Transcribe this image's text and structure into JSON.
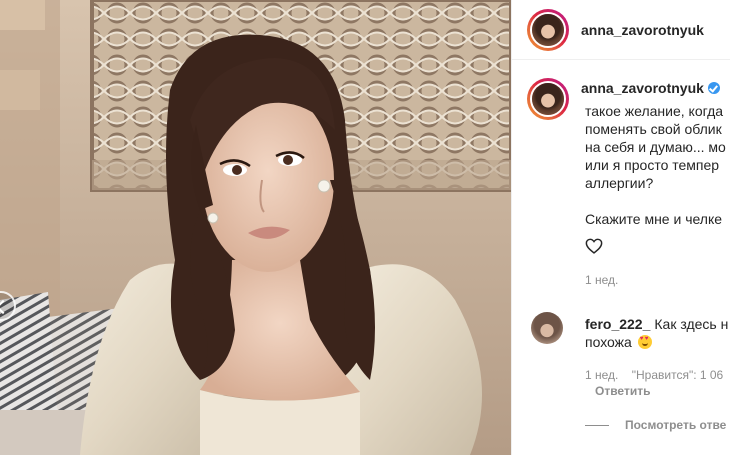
{
  "header": {
    "username": "anna_zavorotnyuk"
  },
  "post": {
    "username": "anna_zavorotnyuk",
    "verified_icon": "verified-badge-icon",
    "caption_lines": [
      "такое желание, когда",
      "поменять свой облик",
      "на себя и думаю... мо",
      "или я просто темпер",
      "аллергии?"
    ],
    "caption_line2": "Скажите мне и челке",
    "time_ago": "1 нед."
  },
  "comment": {
    "username": "fero_222_",
    "text_line1": "Как здесь н",
    "text_line2": "похожа",
    "emoji": "heart-eyes-emoji",
    "time_ago": "1 нед.",
    "likes": "\"Нравится\": 1 06",
    "reply_label": "Ответить",
    "view_replies_label": "Посмотреть отве"
  },
  "colors": {
    "text": "#262626",
    "muted": "#8e8e8e",
    "verified": "#3897f0",
    "story_ring": "#dc2743"
  }
}
